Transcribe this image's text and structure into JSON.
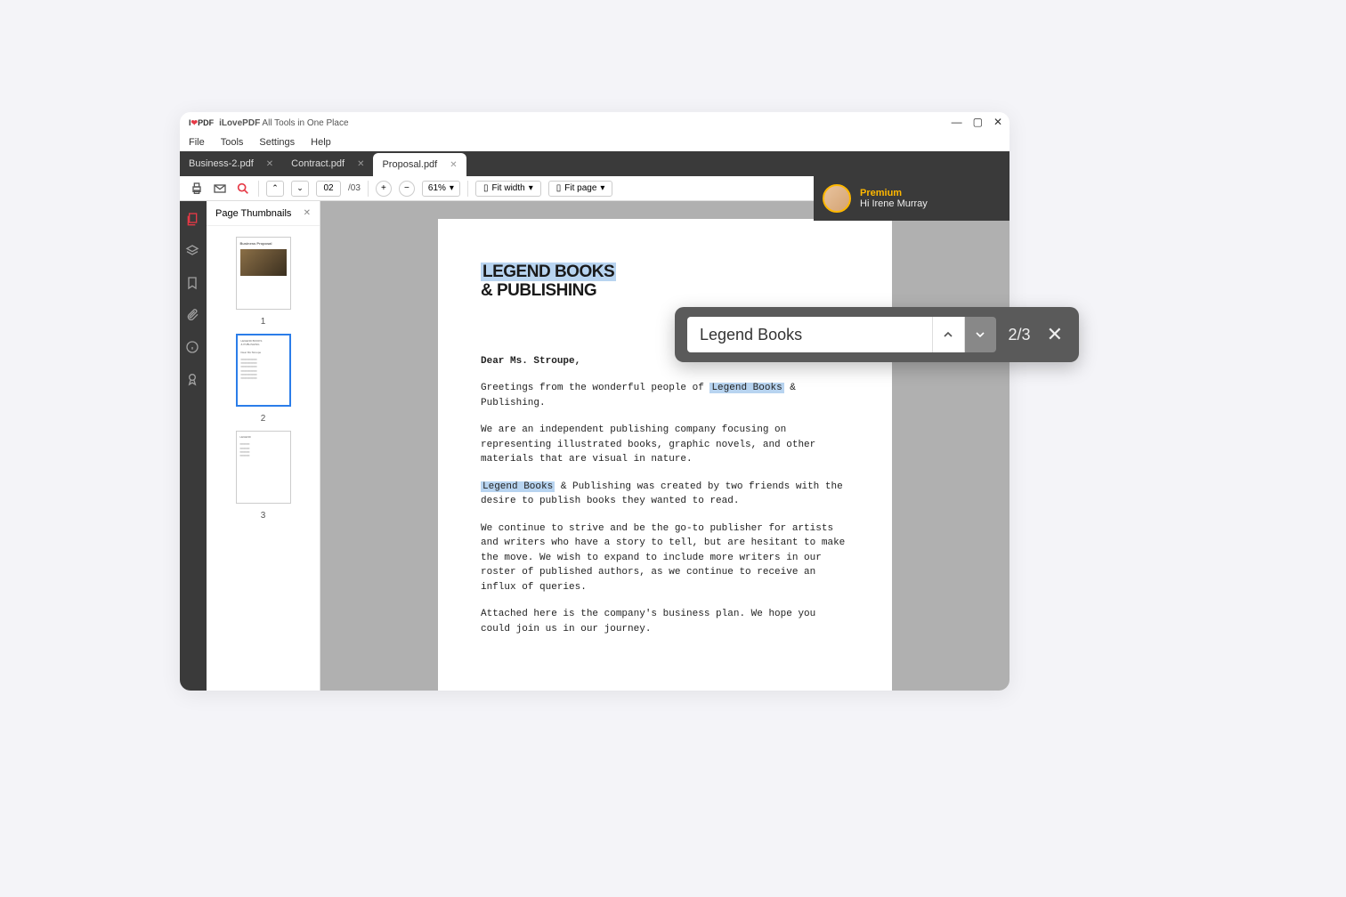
{
  "app": {
    "name": "iLovePDF",
    "tagline": "All Tools in One Place"
  },
  "menu": [
    "File",
    "Tools",
    "Settings",
    "Help"
  ],
  "tabs": [
    {
      "label": "Business-2.pdf",
      "active": false
    },
    {
      "label": "Contract.pdf",
      "active": false
    },
    {
      "label": "Proposal.pdf",
      "active": true
    }
  ],
  "user": {
    "tier": "Premium",
    "greeting": "Hi Irene Murray"
  },
  "toolbar": {
    "page_current": "02",
    "page_total": "/03",
    "zoom": "61%",
    "fit_width": "Fit width",
    "fit_page": "Fit page"
  },
  "sidebar": {
    "panel_title": "Page Thumbnails",
    "thumbs": [
      "1",
      "2",
      "3"
    ]
  },
  "document": {
    "title_line1": "LEGEND BOOKS",
    "title_line2": "& PUBLISHING",
    "salutation": "Dear Ms. Stroupe,",
    "p1_a": "Greetings from the wonderful people of ",
    "p1_hl": "Legend Books",
    "p1_b": " & Publishing.",
    "p2": "We are an independent publishing company focusing on representing illustrated books, graphic novels, and other materials that are visual in nature.",
    "p3_hl": "Legend Books",
    "p3_b": " & Publishing was created by two friends with the desire to publish books they wanted to read.",
    "p4": "We continue to strive and be the go-to publisher for artists and writers who have a story to tell, but are hesitant to make the move. We wish to expand to include more writers in our roster of published authors, as we continue to receive an influx of queries.",
    "p5": "Attached here is the company's business plan. We hope you could join us in our journey."
  },
  "search": {
    "query": "Legend Books",
    "count": "2/3"
  }
}
